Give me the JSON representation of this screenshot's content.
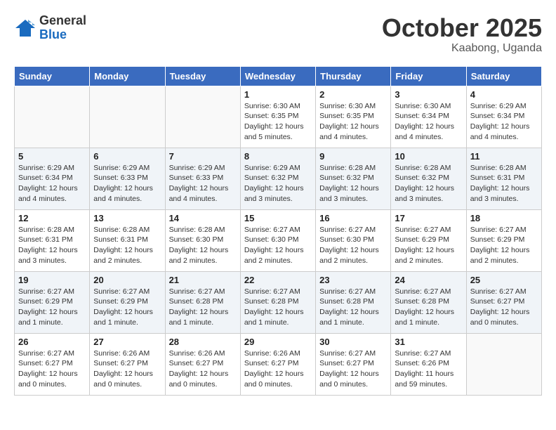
{
  "logo": {
    "general": "General",
    "blue": "Blue"
  },
  "header": {
    "month": "October 2025",
    "location": "Kaabong, Uganda"
  },
  "days_of_week": [
    "Sunday",
    "Monday",
    "Tuesday",
    "Wednesday",
    "Thursday",
    "Friday",
    "Saturday"
  ],
  "weeks": [
    [
      {
        "num": "",
        "info": ""
      },
      {
        "num": "",
        "info": ""
      },
      {
        "num": "",
        "info": ""
      },
      {
        "num": "1",
        "info": "Sunrise: 6:30 AM\nSunset: 6:35 PM\nDaylight: 12 hours\nand 5 minutes."
      },
      {
        "num": "2",
        "info": "Sunrise: 6:30 AM\nSunset: 6:35 PM\nDaylight: 12 hours\nand 4 minutes."
      },
      {
        "num": "3",
        "info": "Sunrise: 6:30 AM\nSunset: 6:34 PM\nDaylight: 12 hours\nand 4 minutes."
      },
      {
        "num": "4",
        "info": "Sunrise: 6:29 AM\nSunset: 6:34 PM\nDaylight: 12 hours\nand 4 minutes."
      }
    ],
    [
      {
        "num": "5",
        "info": "Sunrise: 6:29 AM\nSunset: 6:34 PM\nDaylight: 12 hours\nand 4 minutes."
      },
      {
        "num": "6",
        "info": "Sunrise: 6:29 AM\nSunset: 6:33 PM\nDaylight: 12 hours\nand 4 minutes."
      },
      {
        "num": "7",
        "info": "Sunrise: 6:29 AM\nSunset: 6:33 PM\nDaylight: 12 hours\nand 4 minutes."
      },
      {
        "num": "8",
        "info": "Sunrise: 6:29 AM\nSunset: 6:32 PM\nDaylight: 12 hours\nand 3 minutes."
      },
      {
        "num": "9",
        "info": "Sunrise: 6:28 AM\nSunset: 6:32 PM\nDaylight: 12 hours\nand 3 minutes."
      },
      {
        "num": "10",
        "info": "Sunrise: 6:28 AM\nSunset: 6:32 PM\nDaylight: 12 hours\nand 3 minutes."
      },
      {
        "num": "11",
        "info": "Sunrise: 6:28 AM\nSunset: 6:31 PM\nDaylight: 12 hours\nand 3 minutes."
      }
    ],
    [
      {
        "num": "12",
        "info": "Sunrise: 6:28 AM\nSunset: 6:31 PM\nDaylight: 12 hours\nand 3 minutes."
      },
      {
        "num": "13",
        "info": "Sunrise: 6:28 AM\nSunset: 6:31 PM\nDaylight: 12 hours\nand 2 minutes."
      },
      {
        "num": "14",
        "info": "Sunrise: 6:28 AM\nSunset: 6:30 PM\nDaylight: 12 hours\nand 2 minutes."
      },
      {
        "num": "15",
        "info": "Sunrise: 6:27 AM\nSunset: 6:30 PM\nDaylight: 12 hours\nand 2 minutes."
      },
      {
        "num": "16",
        "info": "Sunrise: 6:27 AM\nSunset: 6:30 PM\nDaylight: 12 hours\nand 2 minutes."
      },
      {
        "num": "17",
        "info": "Sunrise: 6:27 AM\nSunset: 6:29 PM\nDaylight: 12 hours\nand 2 minutes."
      },
      {
        "num": "18",
        "info": "Sunrise: 6:27 AM\nSunset: 6:29 PM\nDaylight: 12 hours\nand 2 minutes."
      }
    ],
    [
      {
        "num": "19",
        "info": "Sunrise: 6:27 AM\nSunset: 6:29 PM\nDaylight: 12 hours\nand 1 minute."
      },
      {
        "num": "20",
        "info": "Sunrise: 6:27 AM\nSunset: 6:29 PM\nDaylight: 12 hours\nand 1 minute."
      },
      {
        "num": "21",
        "info": "Sunrise: 6:27 AM\nSunset: 6:28 PM\nDaylight: 12 hours\nand 1 minute."
      },
      {
        "num": "22",
        "info": "Sunrise: 6:27 AM\nSunset: 6:28 PM\nDaylight: 12 hours\nand 1 minute."
      },
      {
        "num": "23",
        "info": "Sunrise: 6:27 AM\nSunset: 6:28 PM\nDaylight: 12 hours\nand 1 minute."
      },
      {
        "num": "24",
        "info": "Sunrise: 6:27 AM\nSunset: 6:28 PM\nDaylight: 12 hours\nand 1 minute."
      },
      {
        "num": "25",
        "info": "Sunrise: 6:27 AM\nSunset: 6:27 PM\nDaylight: 12 hours\nand 0 minutes."
      }
    ],
    [
      {
        "num": "26",
        "info": "Sunrise: 6:27 AM\nSunset: 6:27 PM\nDaylight: 12 hours\nand 0 minutes."
      },
      {
        "num": "27",
        "info": "Sunrise: 6:26 AM\nSunset: 6:27 PM\nDaylight: 12 hours\nand 0 minutes."
      },
      {
        "num": "28",
        "info": "Sunrise: 6:26 AM\nSunset: 6:27 PM\nDaylight: 12 hours\nand 0 minutes."
      },
      {
        "num": "29",
        "info": "Sunrise: 6:26 AM\nSunset: 6:27 PM\nDaylight: 12 hours\nand 0 minutes."
      },
      {
        "num": "30",
        "info": "Sunrise: 6:27 AM\nSunset: 6:27 PM\nDaylight: 12 hours\nand 0 minutes."
      },
      {
        "num": "31",
        "info": "Sunrise: 6:27 AM\nSunset: 6:26 PM\nDaylight: 11 hours\nand 59 minutes."
      },
      {
        "num": "",
        "info": ""
      }
    ]
  ]
}
